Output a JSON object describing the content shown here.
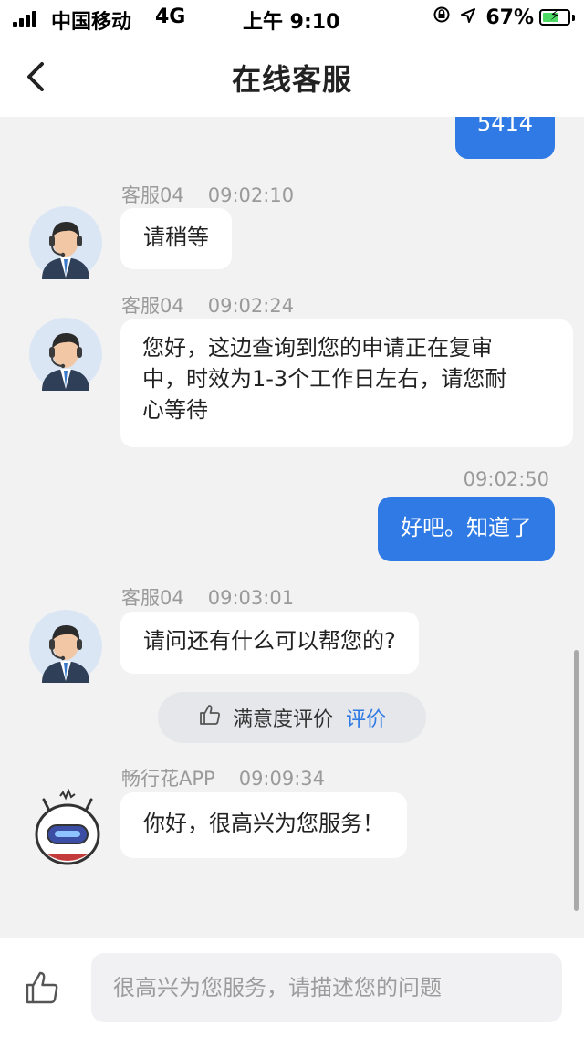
{
  "status_bar": {
    "carrier": "中国移动",
    "network": "4G",
    "time": "上午 9:10",
    "battery": "67%",
    "battery_level": 0.67
  },
  "nav": {
    "title": "在线客服",
    "back_icon": "chevron-left-icon"
  },
  "colors": {
    "accent": "#2f7ae5",
    "background": "#f2f2f2",
    "bubble_left": "#ffffff"
  },
  "messages": [
    {
      "side": "right",
      "text": "5414"
    },
    {
      "side": "left",
      "sender": "客服04",
      "time": "09:02:10",
      "text": "请稍等",
      "avatar": "agent-avatar-icon"
    },
    {
      "side": "left",
      "sender": "客服04",
      "time": "09:02:24",
      "lines": [
        "您好，这边查询到您的申请正在复审",
        "中，时效为1-3个工作日左右，请您耐",
        "心等待"
      ],
      "avatar": "agent-avatar-icon"
    },
    {
      "side": "right",
      "time": "09:02:50",
      "text": "好吧。知道了"
    },
    {
      "side": "left",
      "sender": "客服04",
      "time": "09:03:01",
      "text": "请问还有什么可以帮您的?",
      "avatar": "agent-avatar-icon"
    },
    {
      "side": "left",
      "sender": "畅行花APP",
      "time": "09:09:34",
      "text": "你好，很高兴为您服务！",
      "avatar": "robot-avatar-icon"
    }
  ],
  "rating": {
    "label": "满意度评价",
    "link": "评价"
  },
  "input": {
    "placeholder": "很高兴为您服务，请描述您的问题",
    "value": ""
  }
}
